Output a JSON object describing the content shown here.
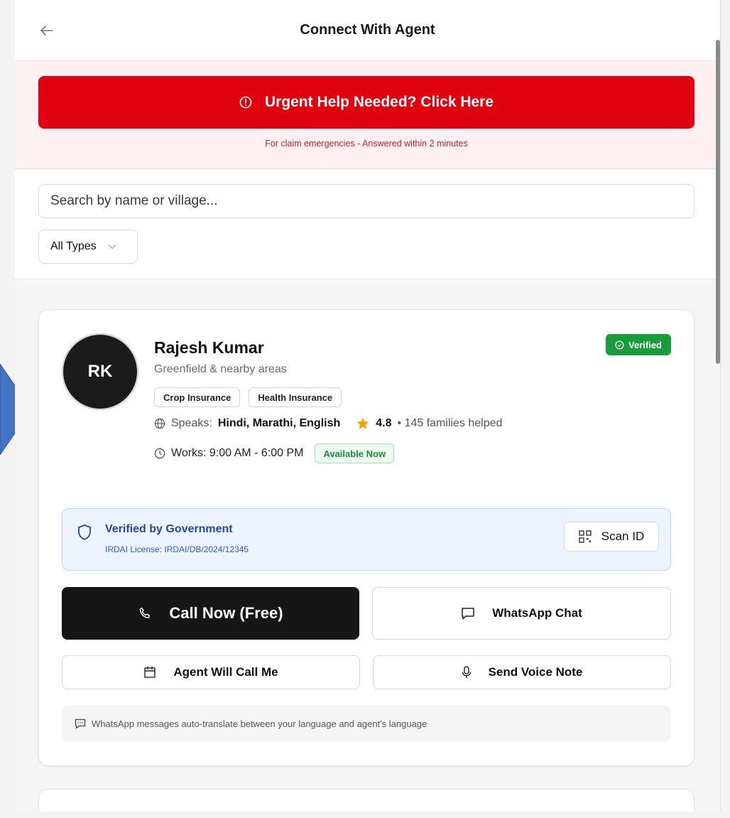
{
  "header": {
    "title": "Connect With Agent",
    "back_icon": "arrow-left-icon"
  },
  "urgent": {
    "button_label": "Urgent Help Needed? Click Here",
    "subtitle": "For claim emergencies - Answered within 2 minutes",
    "icon": "alert-circle-icon",
    "color": "#e0000f"
  },
  "filters": {
    "search_placeholder": "Search by name or village...",
    "type_select": "All Types"
  },
  "agent": {
    "initials": "RK",
    "name": "Rajesh Kumar",
    "area": "Greenfield & nearby areas",
    "verified_label": "Verified",
    "tags": [
      "Crop Insurance",
      "Health Insurance"
    ],
    "speaks_label": "Speaks:",
    "languages": "Hindi, Marathi, English",
    "rating": "4.8",
    "families": "• 145 families helped",
    "works": "Works: 9:00 AM - 6:00 PM",
    "availability": "Available Now",
    "gov_title": "Verified by Government",
    "license": "IRDAI License: IRDAI/DB/2024/12345",
    "scan_label": "Scan ID",
    "call_label": "Call Now (Free)",
    "whatsapp_label": "WhatsApp Chat",
    "callback_label": "Agent Will Call Me",
    "voice_label": "Send Voice Note",
    "note": "WhatsApp messages auto-translate between your language and agent's language"
  },
  "colors": {
    "accent_green": "#1a9b3c",
    "accent_blue": "#1f48a8",
    "dark": "#161616",
    "star": "#f5a300"
  }
}
